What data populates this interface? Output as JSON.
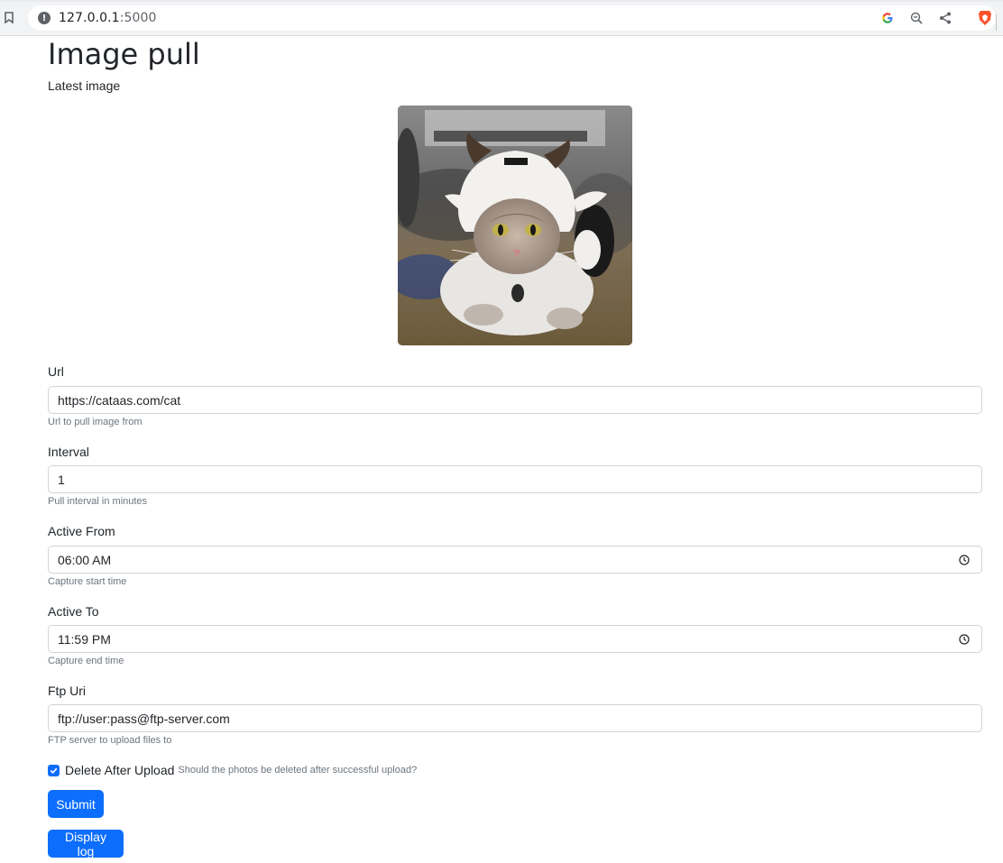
{
  "browser": {
    "url_host": "127.0.0.1",
    "url_port": ":5000",
    "icons": [
      "bookmark-icon",
      "info-icon",
      "google-icon",
      "zoom-out-icon",
      "share-icon",
      "brave-icon"
    ]
  },
  "page": {
    "title": "Image pull",
    "latest_label": "Latest image",
    "image_alt": "cat"
  },
  "form": {
    "url": {
      "label": "Url",
      "value": "https://cataas.com/cat",
      "help": "Url to pull image from"
    },
    "interval": {
      "label": "Interval",
      "value": "1",
      "help": "Pull interval in minutes"
    },
    "active_from": {
      "label": "Active From",
      "value": "06:00 AM",
      "help": "Capture start time"
    },
    "active_to": {
      "label": "Active To",
      "value": "11:59 PM",
      "help": "Capture end time"
    },
    "ftp_uri": {
      "label": "Ftp Uri",
      "value": "ftp://user:pass@ftp-server.com",
      "help": "FTP server to upload files to"
    },
    "delete_after_upload": {
      "label": "Delete After Upload",
      "checked": true,
      "help": "Should the photos be deleted after successful upload?"
    },
    "submit_label": "Submit",
    "display_log_label": "Display log"
  },
  "colors": {
    "primary": "#0d6efd",
    "muted": "#6c757d",
    "border": "#ced4da"
  }
}
